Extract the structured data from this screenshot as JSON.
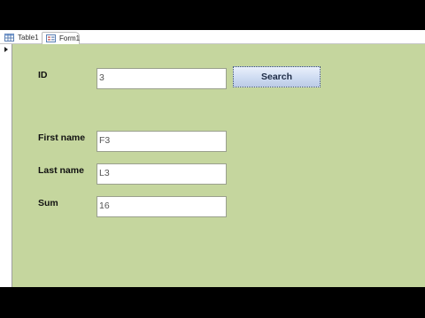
{
  "tabs": [
    {
      "label": "Table1",
      "icon": "table-icon",
      "active": false
    },
    {
      "label": "Form1",
      "icon": "form-icon",
      "active": true
    }
  ],
  "form": {
    "fields": [
      {
        "label": "ID",
        "value": "3"
      },
      {
        "label": "First name",
        "value": "F3"
      },
      {
        "label": "Last name",
        "value": "L3"
      },
      {
        "label": "Sum",
        "value": "16"
      }
    ],
    "search_button": "Search"
  },
  "colors": {
    "form_background": "#c5d69e",
    "button_gradient_top": "#e9f0fb",
    "button_gradient_bottom": "#bccbe6"
  }
}
